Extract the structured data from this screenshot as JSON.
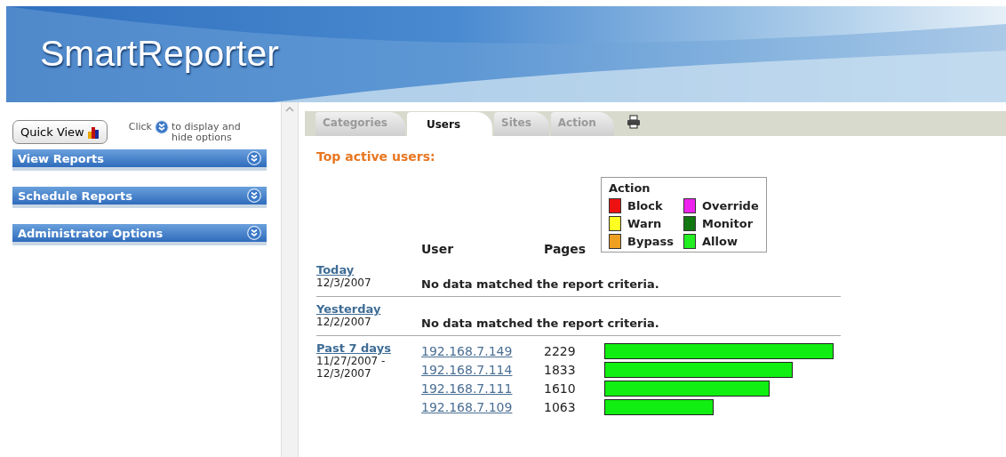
{
  "header": {
    "title": "SmartReporter"
  },
  "sidebar": {
    "quick_view": "Quick View",
    "hint_before": "Click",
    "hint_after": "to display and hide options",
    "sections": [
      {
        "label": "View Reports",
        "expanded": false
      },
      {
        "label": "Schedule Reports",
        "expanded": false
      },
      {
        "label": "Administrator Options",
        "expanded": false
      }
    ]
  },
  "tabs": [
    {
      "label": "Categories",
      "selected": false
    },
    {
      "label": "Users",
      "selected": true
    },
    {
      "label": "Sites",
      "selected": false
    },
    {
      "label": "Action",
      "selected": false
    }
  ],
  "heading": "Top active users:",
  "columns": {
    "user": "User",
    "pages": "Pages"
  },
  "legend": {
    "title": "Action",
    "items": [
      {
        "label": "Block",
        "color": "#ee1111"
      },
      {
        "label": "Override",
        "color": "#ee22ee"
      },
      {
        "label": "Warn",
        "color": "#ffff22"
      },
      {
        "label": "Monitor",
        "color": "#117711"
      },
      {
        "label": "Bypass",
        "color": "#f0a020"
      },
      {
        "label": "Allow",
        "color": "#22ee22"
      }
    ]
  },
  "periods": [
    {
      "label": "Today",
      "dates": [
        "12/3/2007"
      ],
      "message": "No data matched the report criteria."
    },
    {
      "label": "Yesterday",
      "dates": [
        "12/2/2007"
      ],
      "message": "No data matched the report criteria."
    },
    {
      "label": "Past 7 days",
      "dates": [
        "11/27/2007 -",
        "12/3/2007"
      ],
      "rows": [
        {
          "user": "192.168.7.149",
          "pages": "2229"
        },
        {
          "user": "192.168.7.114",
          "pages": "1833"
        },
        {
          "user": "192.168.7.111",
          "pages": "1610"
        },
        {
          "user": "192.168.7.109",
          "pages": "1063"
        }
      ]
    }
  ]
}
